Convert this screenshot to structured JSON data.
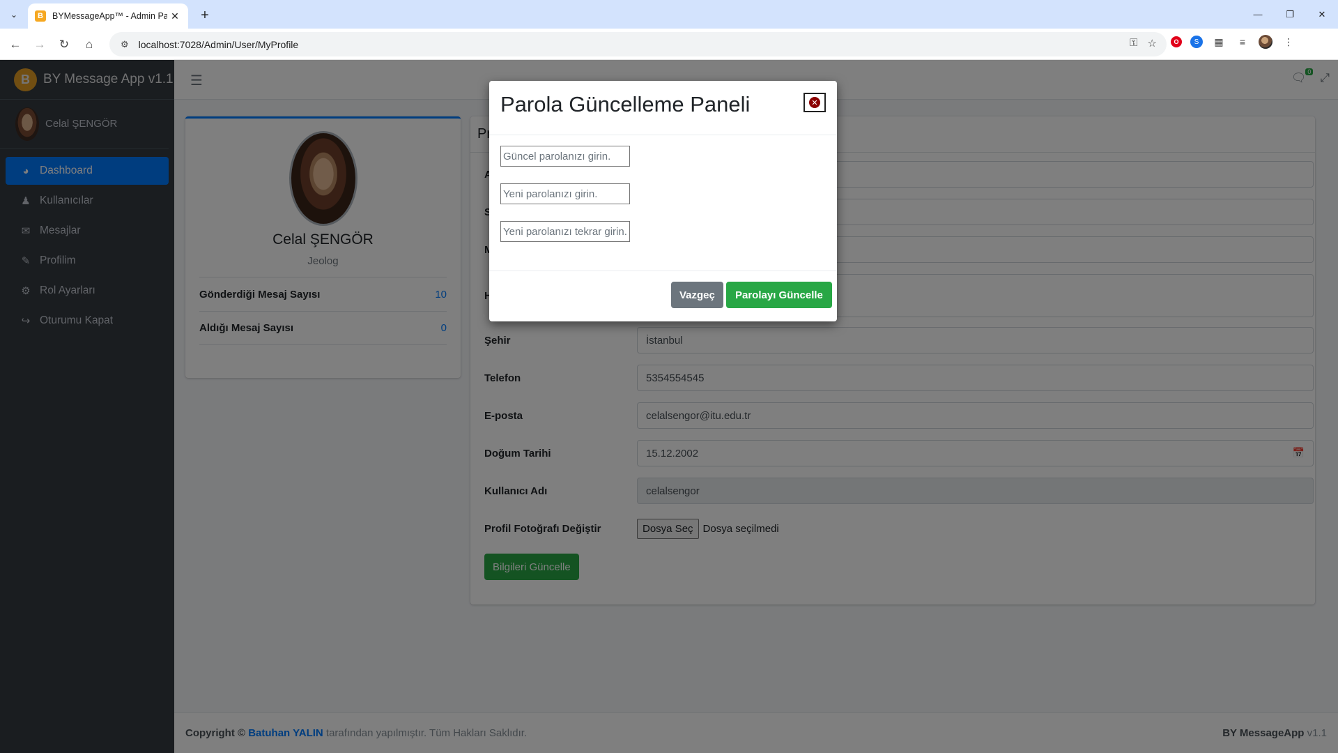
{
  "browser": {
    "tab_title": "BYMessageApp™ - Admin Panel",
    "url": "localhost:7028/Admin/User/MyProfile"
  },
  "sidebar": {
    "brand": "BY Message App v1.1",
    "user_name": "Celal ŞENGÖR",
    "items": [
      {
        "label": "Dashboard",
        "icon": "dashboard-icon"
      },
      {
        "label": "Kullanıcılar",
        "icon": "user-icon"
      },
      {
        "label": "Mesajlar",
        "icon": "envelope-icon"
      },
      {
        "label": "Profilim",
        "icon": "user-edit-icon"
      },
      {
        "label": "Rol Ayarları",
        "icon": "gears-icon"
      },
      {
        "label": "Oturumu Kapat",
        "icon": "sign-out-icon"
      }
    ]
  },
  "topnav": {
    "chat_count": "0"
  },
  "profile": {
    "name": "Celal ŞENGÖR",
    "role": "Jeolog",
    "stats": [
      {
        "label": "Gönderdiği Mesaj Sayısı",
        "value": "10"
      },
      {
        "label": "Aldığı Mesaj Sayısı",
        "value": "0"
      }
    ]
  },
  "form": {
    "title_partial": "Pr",
    "labels_partial": [
      "A",
      "S",
      "M",
      "H"
    ],
    "fields": [
      {
        "label": "Şehir",
        "value": "İstanbul"
      },
      {
        "label": "Telefon",
        "value": "5354554545"
      },
      {
        "label": "E-posta",
        "value": "celalsengor@itu.edu.tr"
      },
      {
        "label": "Doğum Tarihi",
        "value": "15.12.2002"
      },
      {
        "label": "Kullanıcı Adı",
        "value": "celalsengor"
      }
    ],
    "photo_label": "Profil Fotoğrafı Değiştir",
    "file_button": "Dosya Seç",
    "file_status": "Dosya seçilmedi",
    "submit": "Bilgileri Güncelle"
  },
  "footer": {
    "copyright": "Copyright ©",
    "author": "Batuhan YALIN",
    "rights": "tarafından yapılmıştır. Tüm Hakları Saklıdır.",
    "brand": "BY MessageApp",
    "version": "v1.1"
  },
  "modal": {
    "title": "Parola Güncelleme Paneli",
    "current_placeholder": "Güncel parolanızı girin.",
    "new_placeholder": "Yeni parolanızı girin.",
    "repeat_placeholder": "Yeni parolanızı tekrar girin.",
    "cancel": "Vazgeç",
    "confirm": "Parolayı Güncelle"
  },
  "colors": {
    "sidebar_bg": "#343a40",
    "active": "#007bff",
    "success": "#28a745",
    "secondary": "#6c757d"
  }
}
